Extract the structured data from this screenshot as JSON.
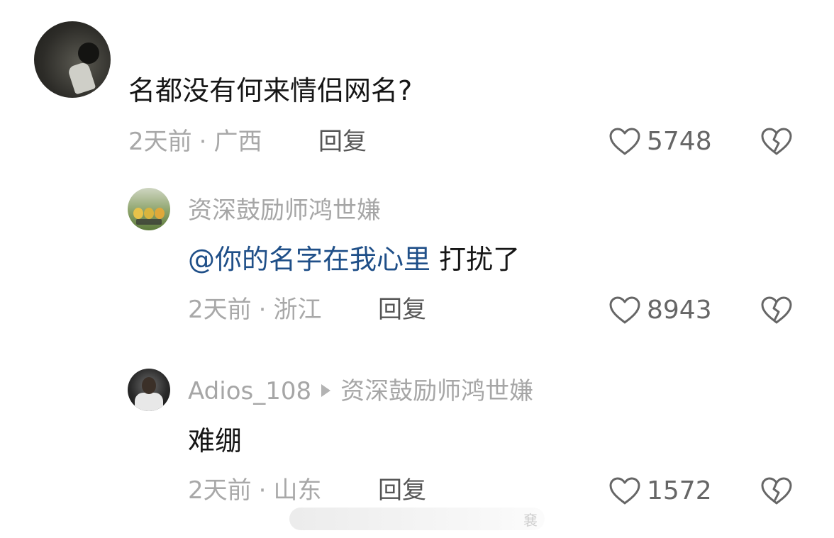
{
  "comment_main": {
    "content": "名都没有何来情侣网名?",
    "time": "2天前",
    "location": "广西",
    "reply_label": "回复",
    "likes": "5748"
  },
  "reply_1": {
    "username": "资深鼓励师鸿世嫌",
    "mention": "@你的名字在我心里",
    "content": " 打扰了",
    "time": "2天前",
    "location": "浙江",
    "reply_label": "回复",
    "likes": "8943"
  },
  "reply_2": {
    "username": "Adios_108",
    "reply_to": "资深鼓励师鸿世嫌",
    "content": "难绷",
    "time": "2天前",
    "location": "山东",
    "reply_label": "回复",
    "likes": "1572"
  },
  "separator": "·",
  "watermark": "㐮",
  "icons": {
    "like": "heart-outline-icon",
    "dislike": "broken-heart-icon"
  },
  "colors": {
    "mention": "#1f4f88",
    "meta": "#a8a8a8",
    "username": "#a6a6a6"
  }
}
